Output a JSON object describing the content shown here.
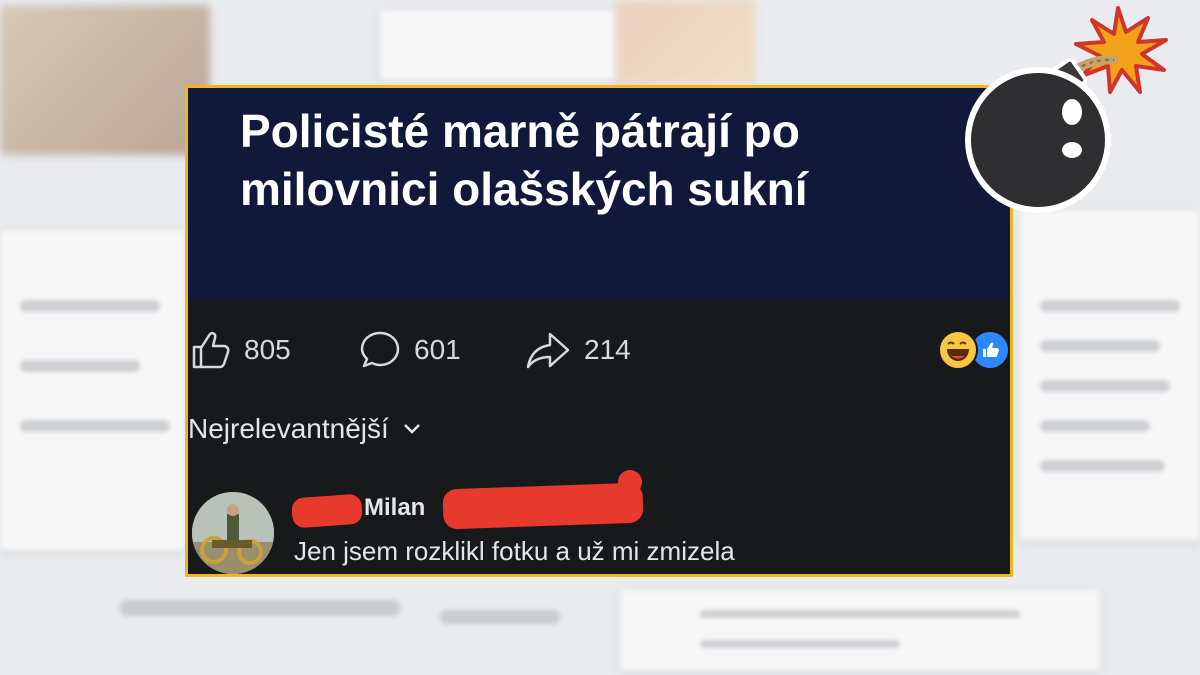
{
  "post": {
    "headline": "Policisté marně pátrají po milovnici olašských sukní",
    "stats": {
      "likes": "805",
      "comments": "601",
      "shares": "214"
    }
  },
  "comments_section": {
    "sort_label": "Nejrelevantnější",
    "comment": {
      "author_visible_name": "Milan",
      "text": "Jen jsem rozklikl fotku a už mi zmizela"
    }
  },
  "colors": {
    "frame_border": "#f0b61e",
    "headline_bg": "#11193a",
    "redaction": "#e8392d"
  },
  "icons": [
    "like-icon",
    "comment-icon",
    "share-icon",
    "haha-reaction-icon",
    "like-reaction-icon",
    "chevron-down-icon",
    "bomb-icon"
  ]
}
